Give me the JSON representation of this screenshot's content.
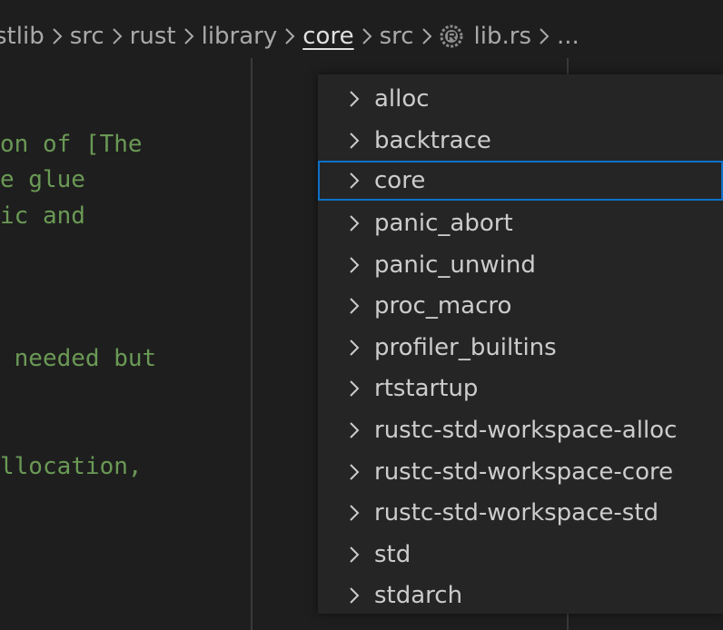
{
  "breadcrumb": {
    "items": [
      {
        "label": "stlib"
      },
      {
        "label": "src"
      },
      {
        "label": "rust"
      },
      {
        "label": "library"
      },
      {
        "label": "core"
      },
      {
        "label": "src"
      },
      {
        "label": "lib.rs"
      },
      {
        "label": "..."
      }
    ],
    "active": "core"
  },
  "editor": {
    "lines": [
      "on of [The",
      "e glue",
      "ic and",
      " needed but",
      "llocation,"
    ]
  },
  "dropdown": {
    "selected": "core",
    "items": [
      {
        "label": "alloc"
      },
      {
        "label": "backtrace"
      },
      {
        "label": "core"
      },
      {
        "label": "panic_abort"
      },
      {
        "label": "panic_unwind"
      },
      {
        "label": "proc_macro"
      },
      {
        "label": "profiler_builtins"
      },
      {
        "label": "rtstartup"
      },
      {
        "label": "rustc-std-workspace-alloc"
      },
      {
        "label": "rustc-std-workspace-core"
      },
      {
        "label": "rustc-std-workspace-std"
      },
      {
        "label": "std"
      },
      {
        "label": "stdarch"
      }
    ]
  },
  "colors": {
    "comment": "#6a9955",
    "selection_border": "#0e71c8",
    "dropdown_bg": "#252526",
    "editor_bg": "#1e1e1e"
  }
}
